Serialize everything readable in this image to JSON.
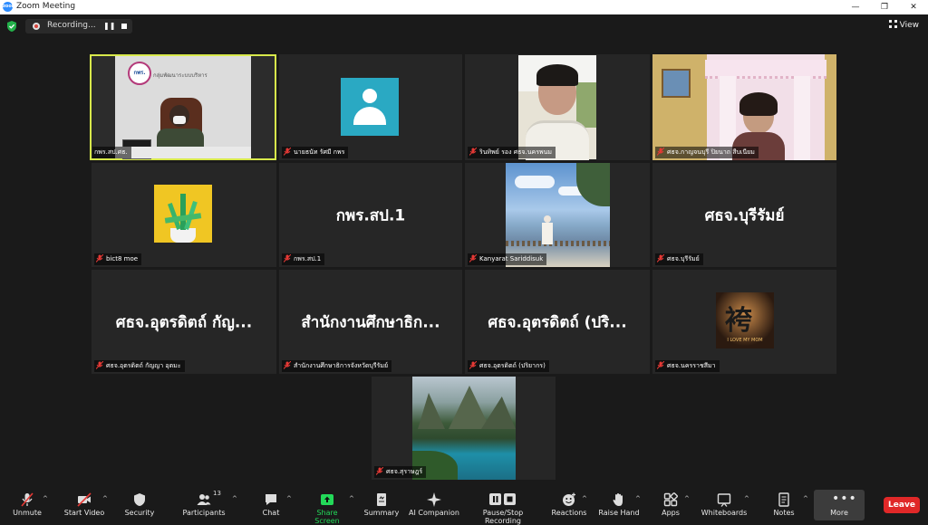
{
  "window": {
    "title": "Zoom Meeting",
    "logo_text": "zoom"
  },
  "recording": {
    "status": "Recording..."
  },
  "view_label": "View",
  "tiles": [
    {
      "name": "กพร.สป.ศธ.",
      "big": "",
      "kind": "video-office",
      "active": true
    },
    {
      "name": "นายธนัท รัศมี กพร",
      "big": "",
      "kind": "avatar"
    },
    {
      "name": "รินทิพย์ รอง ศธจ.นครพนม",
      "big": "",
      "kind": "video-person"
    },
    {
      "name": "ศธจ.กาญจนบุรี ปิยนาถ สืบเนียม",
      "big": "",
      "kind": "video-room"
    },
    {
      "name": "bict8 moe",
      "big": "",
      "kind": "plant"
    },
    {
      "name": "กพร.สป.1",
      "big": "กพร.สป.1",
      "kind": "text"
    },
    {
      "name": "Kanyarat Sariddisuk",
      "big": "",
      "kind": "beach"
    },
    {
      "name": "ศธจ.บุรีรัมย์",
      "big": "ศธจ.บุรีรัมย์",
      "kind": "text"
    },
    {
      "name": "ศธจ.อุตรดิตถ์ กัญญา อุตมะ",
      "big": "ศธจ.อุตรดิตถ์ กัญ...",
      "kind": "text"
    },
    {
      "name": "สำนักงานศึกษาธิการจังหวัดบุรีรัมย์",
      "big": "สำนักงานศึกษาธิก...",
      "kind": "text"
    },
    {
      "name": "ศธจ.อุตรดิตถ์ (ปริยากร)",
      "big": "ศธจ.อุตรดิตถ์ (ปริ...",
      "kind": "text"
    },
    {
      "name": "ศธจ.นครราชสีมา",
      "big": "",
      "kind": "poster"
    },
    {
      "name": "ศธจ.สุราษฎร์",
      "big": "",
      "kind": "mountain"
    }
  ],
  "office": {
    "sign": "กลุ่มพัฒนาระบบบริหาร",
    "logo": "กพร."
  },
  "poster": {
    "caption": "I LOVE MY MOM"
  },
  "toolbar": {
    "unmute": "Unmute",
    "start_video": "Start Video",
    "security": "Security",
    "participants": "Participants",
    "participants_count": "13",
    "chat": "Chat",
    "share_screen": "Share Screen",
    "summary": "Summary",
    "ai_companion": "AI Companion",
    "pause_stop": "Pause/Stop Recording",
    "reactions": "Reactions",
    "raise_hand": "Raise Hand",
    "apps": "Apps",
    "whiteboards": "Whiteboards",
    "notes": "Notes",
    "more": "More",
    "leave": "Leave"
  },
  "colors": {
    "accent_active": "#d8e94b",
    "share_green": "#23d959",
    "leave_red": "#e02828"
  }
}
